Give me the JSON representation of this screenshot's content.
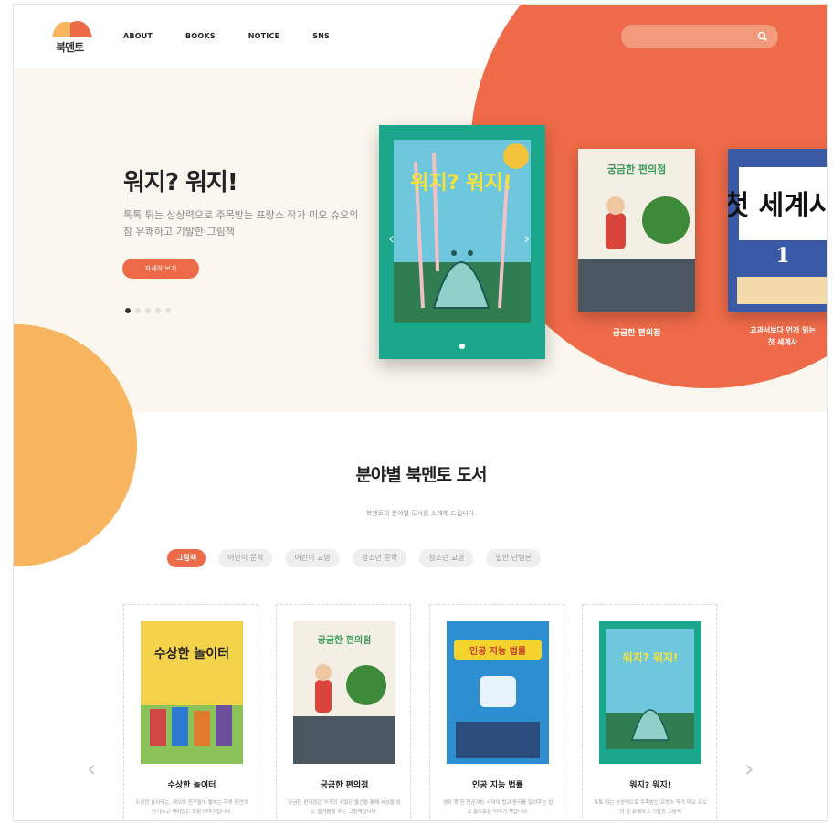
{
  "brand": {
    "logo_text": "북멘토"
  },
  "nav": {
    "items": [
      "ABOUT",
      "BOOKS",
      "NOTICE",
      "SNS"
    ]
  },
  "search": {
    "placeholder": ""
  },
  "hero": {
    "title": "워지? 워지!",
    "description": "톡톡 튀는 상상력으로 주목받는 프랑스 작가 미오 슈오의 참 유쾌하고 기발한 그림책",
    "button_label": "자세히 보기",
    "slides_total": 5,
    "slide_active": 1,
    "book_main_title": "워지? 워지!",
    "book2_title": "궁금한 편의점",
    "book2_label": "궁금한 편의점",
    "book3_cover_text": "첫 세계사",
    "book3_cover_num": "1",
    "book3_label_line1": "교과서보다 먼저 읽는",
    "book3_label_line2": "첫 세계사"
  },
  "section": {
    "title": "분야별 북멘토 도서",
    "subtitle": "북멘토의 분야별 도서를 소개해 드립니다.",
    "tabs": [
      {
        "label": "그림책",
        "active": true
      },
      {
        "label": "어린이 문학",
        "active": false
      },
      {
        "label": "어린이 교양",
        "active": false
      },
      {
        "label": "청소년 문학",
        "active": false
      },
      {
        "label": "청소년 교양",
        "active": false
      },
      {
        "label": "일반 단행본",
        "active": false
      }
    ],
    "books": [
      {
        "title": "수상한 놀이터",
        "cover_text": "수상한 놀이터",
        "desc": "수상한 놀이터는, 레오와 친구들이 펼치는 하루 동안의 신기하고 재미있는 모험 이야기입니다."
      },
      {
        "title": "궁금한 편의점",
        "cover_text": "궁금한 편의점",
        "desc": "궁금한 편의점은 가게의 수많은 물건을 통해 세상을 읽는 즐거움을 주는 그림책입니다."
      },
      {
        "title": "인공 지능 법률",
        "cover_text": "인공 지능 법률",
        "desc": "생각 못 한 인공지능 시대의 법과 윤리를 알려주는 쉽고 흥미로운 이야기 책입니다."
      },
      {
        "title": "워지? 워지!",
        "cover_text": "워지? 워지!",
        "desc": "톡톡 튀는 상상력으로 주목받는 프랑스 작가 미오 슈오의 참 유쾌하고 기발한 그림책"
      }
    ]
  },
  "colors": {
    "accent": "#ec6a48",
    "yellow": "#f8b55f",
    "teal": "#1aa78b",
    "cream": "#fbf6ee"
  }
}
